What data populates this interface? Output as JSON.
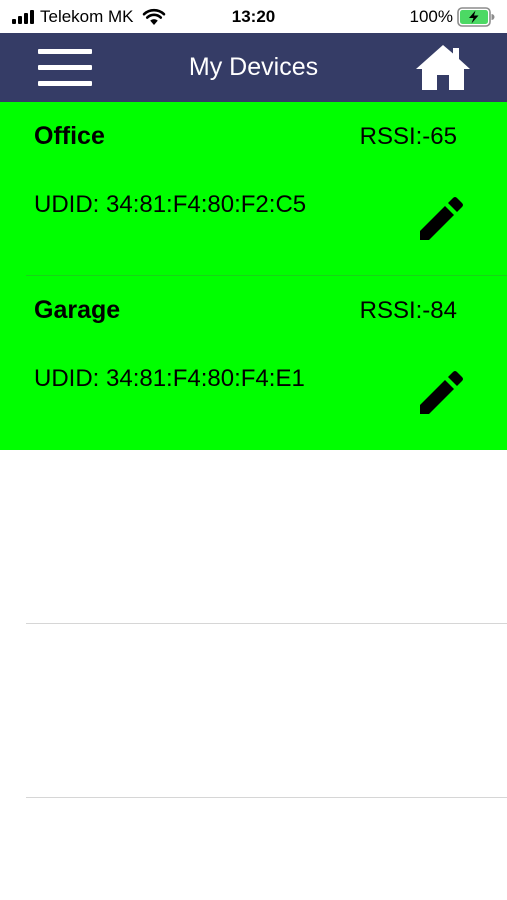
{
  "status_bar": {
    "carrier": "Telekom MK",
    "time": "13:20",
    "battery": "100%"
  },
  "nav": {
    "title": "My Devices"
  },
  "devices": [
    {
      "name": "Office",
      "rssi": "RSSI:-65",
      "udid": "UDID: 34:81:F4:80:F2:C5"
    },
    {
      "name": "Garage",
      "rssi": "RSSI:-84",
      "udid": "UDID: 34:81:F4:80:F4:E1"
    }
  ],
  "colors": {
    "nav_background": "#353C66",
    "device_row_background": "#00FF00",
    "battery_charging": "#4CD964"
  },
  "icons": {
    "menu": "hamburger-icon",
    "home": "home-icon",
    "edit": "pencil-icon",
    "wifi": "wifi-icon",
    "signal": "signal-bars-icon",
    "battery": "battery-charging-icon"
  }
}
